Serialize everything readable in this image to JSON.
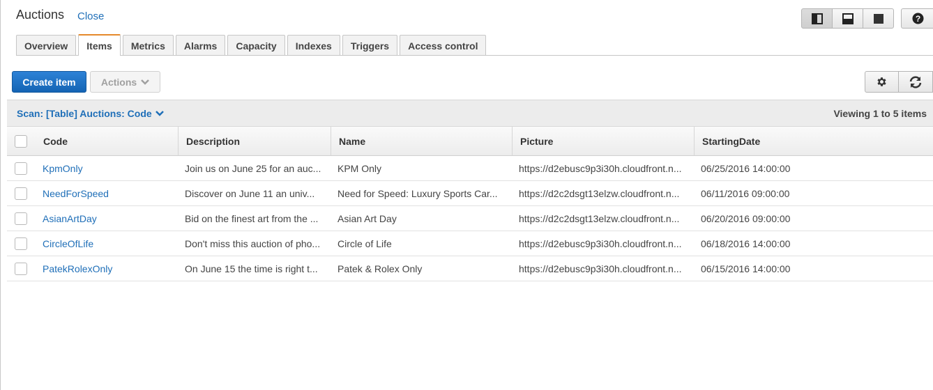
{
  "header": {
    "title": "Auctions",
    "close_label": "Close"
  },
  "layout_buttons": [
    "split-vertical-icon",
    "split-horizontal-icon",
    "full-screen-icon"
  ],
  "help_icon": "help-icon",
  "tabs": [
    {
      "label": "Overview"
    },
    {
      "label": "Items",
      "active": true
    },
    {
      "label": "Metrics"
    },
    {
      "label": "Alarms"
    },
    {
      "label": "Capacity"
    },
    {
      "label": "Indexes"
    },
    {
      "label": "Triggers"
    },
    {
      "label": "Access control"
    }
  ],
  "toolbar": {
    "create_label": "Create item",
    "actions_label": "Actions",
    "settings_icon": "gear-icon",
    "refresh_icon": "refresh-icon"
  },
  "scan": {
    "label": "Scan: [Table] Auctions: Code",
    "viewing": "Viewing 1 to 5 items"
  },
  "table": {
    "columns": [
      "Code",
      "Description",
      "Name",
      "Picture",
      "StartingDate"
    ],
    "rows": [
      [
        "KpmOnly",
        "Join us on June 25 for an auc...",
        "KPM Only",
        "https://d2ebusc9p3i30h.cloudfront.n...",
        "06/25/2016 14:00:00"
      ],
      [
        "NeedForSpeed",
        "Discover on June 11 an univ...",
        "Need for Speed: Luxury Sports Car...",
        "https://d2c2dsgt13elzw.cloudfront.n...",
        "06/11/2016 09:00:00"
      ],
      [
        "AsianArtDay",
        "Bid on the finest art from the ...",
        "Asian Art Day",
        "https://d2c2dsgt13elzw.cloudfront.n...",
        "06/20/2016 09:00:00"
      ],
      [
        "CircleOfLife",
        "Don't miss this auction of pho...",
        "Circle of Life",
        "https://d2ebusc9p3i30h.cloudfront.n...",
        "06/18/2016 14:00:00"
      ],
      [
        "PatekRolexOnly",
        "On June 15 the time is right t...",
        "Patek & Rolex Only",
        "https://d2ebusc9p3i30h.cloudfront.n...",
        "06/15/2016 14:00:00"
      ]
    ]
  },
  "colors": {
    "primary": "#1f6fb8",
    "tab_accent": "#e5892b",
    "link": "#1f6fb8"
  }
}
